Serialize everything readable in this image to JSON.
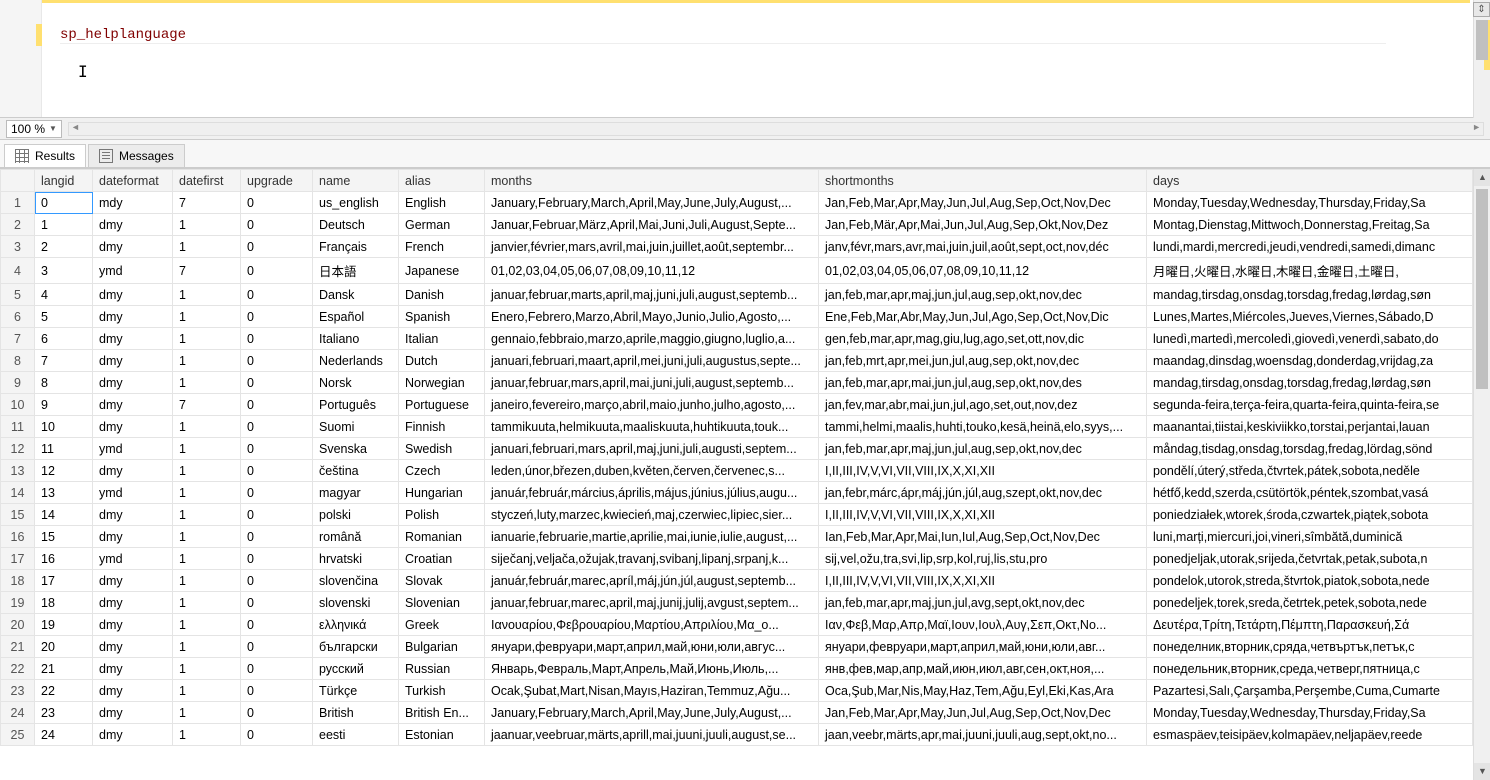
{
  "editor": {
    "sql_text": "sp_helplanguage",
    "zoom_label": "100 %"
  },
  "tabs": {
    "results_label": "Results",
    "messages_label": "Messages"
  },
  "grid": {
    "columns": [
      "langid",
      "dateformat",
      "datefirst",
      "upgrade",
      "name",
      "alias",
      "months",
      "shortmonths",
      "days"
    ],
    "rows": [
      {
        "n": "1",
        "langid": "0",
        "dateformat": "mdy",
        "datefirst": "7",
        "upgrade": "0",
        "name": "us_english",
        "alias": "English",
        "months": "January,February,March,April,May,June,July,August,...",
        "shortmonths": "Jan,Feb,Mar,Apr,May,Jun,Jul,Aug,Sep,Oct,Nov,Dec",
        "days": "Monday,Tuesday,Wednesday,Thursday,Friday,Sa"
      },
      {
        "n": "2",
        "langid": "1",
        "dateformat": "dmy",
        "datefirst": "1",
        "upgrade": "0",
        "name": "Deutsch",
        "alias": "German",
        "months": "Januar,Februar,März,April,Mai,Juni,Juli,August,Septe...",
        "shortmonths": "Jan,Feb,Mär,Apr,Mai,Jun,Jul,Aug,Sep,Okt,Nov,Dez",
        "days": "Montag,Dienstag,Mittwoch,Donnerstag,Freitag,Sa"
      },
      {
        "n": "3",
        "langid": "2",
        "dateformat": "dmy",
        "datefirst": "1",
        "upgrade": "0",
        "name": "Français",
        "alias": "French",
        "months": "janvier,février,mars,avril,mai,juin,juillet,août,septembr...",
        "shortmonths": "janv,févr,mars,avr,mai,juin,juil,août,sept,oct,nov,déc",
        "days": "lundi,mardi,mercredi,jeudi,vendredi,samedi,dimanc"
      },
      {
        "n": "4",
        "langid": "3",
        "dateformat": "ymd",
        "datefirst": "7",
        "upgrade": "0",
        "name": "日本語",
        "alias": "Japanese",
        "months": "01,02,03,04,05,06,07,08,09,10,11,12",
        "shortmonths": "01,02,03,04,05,06,07,08,09,10,11,12",
        "days": "月曜日,火曜日,水曜日,木曜日,金曜日,土曜日,"
      },
      {
        "n": "5",
        "langid": "4",
        "dateformat": "dmy",
        "datefirst": "1",
        "upgrade": "0",
        "name": "Dansk",
        "alias": "Danish",
        "months": "januar,februar,marts,april,maj,juni,juli,august,septemb...",
        "shortmonths": "jan,feb,mar,apr,maj,jun,jul,aug,sep,okt,nov,dec",
        "days": "mandag,tirsdag,onsdag,torsdag,fredag,lørdag,søn"
      },
      {
        "n": "6",
        "langid": "5",
        "dateformat": "dmy",
        "datefirst": "1",
        "upgrade": "0",
        "name": "Español",
        "alias": "Spanish",
        "months": "Enero,Febrero,Marzo,Abril,Mayo,Junio,Julio,Agosto,...",
        "shortmonths": "Ene,Feb,Mar,Abr,May,Jun,Jul,Ago,Sep,Oct,Nov,Dic",
        "days": "Lunes,Martes,Miércoles,Jueves,Viernes,Sábado,D"
      },
      {
        "n": "7",
        "langid": "6",
        "dateformat": "dmy",
        "datefirst": "1",
        "upgrade": "0",
        "name": "Italiano",
        "alias": "Italian",
        "months": "gennaio,febbraio,marzo,aprile,maggio,giugno,luglio,a...",
        "shortmonths": "gen,feb,mar,apr,mag,giu,lug,ago,set,ott,nov,dic",
        "days": "lunedì,martedì,mercoledì,giovedì,venerdì,sabato,do"
      },
      {
        "n": "8",
        "langid": "7",
        "dateformat": "dmy",
        "datefirst": "1",
        "upgrade": "0",
        "name": "Nederlands",
        "alias": "Dutch",
        "months": "januari,februari,maart,april,mei,juni,juli,augustus,septe...",
        "shortmonths": "jan,feb,mrt,apr,mei,jun,jul,aug,sep,okt,nov,dec",
        "days": "maandag,dinsdag,woensdag,donderdag,vrijdag,za"
      },
      {
        "n": "9",
        "langid": "8",
        "dateformat": "dmy",
        "datefirst": "1",
        "upgrade": "0",
        "name": "Norsk",
        "alias": "Norwegian",
        "months": "januar,februar,mars,april,mai,juni,juli,august,septemb...",
        "shortmonths": "jan,feb,mar,apr,mai,jun,jul,aug,sep,okt,nov,des",
        "days": "mandag,tirsdag,onsdag,torsdag,fredag,lørdag,søn"
      },
      {
        "n": "10",
        "langid": "9",
        "dateformat": "dmy",
        "datefirst": "7",
        "upgrade": "0",
        "name": "Português",
        "alias": "Portuguese",
        "months": "janeiro,fevereiro,março,abril,maio,junho,julho,agosto,...",
        "shortmonths": "jan,fev,mar,abr,mai,jun,jul,ago,set,out,nov,dez",
        "days": "segunda-feira,terça-feira,quarta-feira,quinta-feira,se"
      },
      {
        "n": "11",
        "langid": "10",
        "dateformat": "dmy",
        "datefirst": "1",
        "upgrade": "0",
        "name": "Suomi",
        "alias": "Finnish",
        "months": "tammikuuta,helmikuuta,maaliskuuta,huhtikuuta,touk...",
        "shortmonths": "tammi,helmi,maalis,huhti,touko,kesä,heinä,elo,syys,...",
        "days": "maanantai,tiistai,keskiviikko,torstai,perjantai,lauan"
      },
      {
        "n": "12",
        "langid": "11",
        "dateformat": "ymd",
        "datefirst": "1",
        "upgrade": "0",
        "name": "Svenska",
        "alias": "Swedish",
        "months": "januari,februari,mars,april,maj,juni,juli,augusti,septem...",
        "shortmonths": "jan,feb,mar,apr,maj,jun,jul,aug,sep,okt,nov,dec",
        "days": "måndag,tisdag,onsdag,torsdag,fredag,lördag,sönd"
      },
      {
        "n": "13",
        "langid": "12",
        "dateformat": "dmy",
        "datefirst": "1",
        "upgrade": "0",
        "name": "čeština",
        "alias": "Czech",
        "months": "leden,únor,březen,duben,květen,červen,červenec,s...",
        "shortmonths": "I,II,III,IV,V,VI,VII,VIII,IX,X,XI,XII",
        "days": "pondělí,úterý,středa,čtvrtek,pátek,sobota,neděle"
      },
      {
        "n": "14",
        "langid": "13",
        "dateformat": "ymd",
        "datefirst": "1",
        "upgrade": "0",
        "name": "magyar",
        "alias": "Hungarian",
        "months": "január,február,március,április,május,június,július,augu...",
        "shortmonths": "jan,febr,márc,ápr,máj,jún,júl,aug,szept,okt,nov,dec",
        "days": "hétfő,kedd,szerda,csütörtök,péntek,szombat,vasá"
      },
      {
        "n": "15",
        "langid": "14",
        "dateformat": "dmy",
        "datefirst": "1",
        "upgrade": "0",
        "name": "polski",
        "alias": "Polish",
        "months": "styczeń,luty,marzec,kwiecień,maj,czerwiec,lipiec,sier...",
        "shortmonths": "I,II,III,IV,V,VI,VII,VIII,IX,X,XI,XII",
        "days": "poniedziałek,wtorek,środa,czwartek,piątek,sobota"
      },
      {
        "n": "16",
        "langid": "15",
        "dateformat": "dmy",
        "datefirst": "1",
        "upgrade": "0",
        "name": "română",
        "alias": "Romanian",
        "months": "ianuarie,februarie,martie,aprilie,mai,iunie,iulie,august,...",
        "shortmonths": "Ian,Feb,Mar,Apr,Mai,Iun,Iul,Aug,Sep,Oct,Nov,Dec",
        "days": "luni,marți,miercuri,joi,vineri,sîmbătă,duminică"
      },
      {
        "n": "17",
        "langid": "16",
        "dateformat": "ymd",
        "datefirst": "1",
        "upgrade": "0",
        "name": "hrvatski",
        "alias": "Croatian",
        "months": "siječanj,veljača,ožujak,travanj,svibanj,lipanj,srpanj,k...",
        "shortmonths": "sij,vel,ožu,tra,svi,lip,srp,kol,ruj,lis,stu,pro",
        "days": "ponedjeljak,utorak,srijeda,četvrtak,petak,subota,n"
      },
      {
        "n": "18",
        "langid": "17",
        "dateformat": "dmy",
        "datefirst": "1",
        "upgrade": "0",
        "name": "slovenčina",
        "alias": "Slovak",
        "months": "január,február,marec,apríl,máj,jún,júl,august,septemb...",
        "shortmonths": "I,II,III,IV,V,VI,VII,VIII,IX,X,XI,XII",
        "days": "pondelok,utorok,streda,štvrtok,piatok,sobota,nede"
      },
      {
        "n": "19",
        "langid": "18",
        "dateformat": "dmy",
        "datefirst": "1",
        "upgrade": "0",
        "name": "slovenski",
        "alias": "Slovenian",
        "months": "januar,februar,marec,april,maj,junij,julij,avgust,septem...",
        "shortmonths": "jan,feb,mar,apr,maj,jun,jul,avg,sept,okt,nov,dec",
        "days": "ponedeljek,torek,sreda,četrtek,petek,sobota,nede"
      },
      {
        "n": "20",
        "langid": "19",
        "dateformat": "dmy",
        "datefirst": "1",
        "upgrade": "0",
        "name": "ελληνικά",
        "alias": "Greek",
        "months": "Ιανουαρίου,Φεβρουαρίου,Μαρτίου,Απριλίου,Μα_ο...",
        "shortmonths": "Ιαν,Φεβ,Μαρ,Απρ,Μαϊ,Ιουν,Ιουλ,Αυγ,Σεπ,Οκτ,Νο...",
        "days": "Δευτέρα,Τρίτη,Τετάρτη,Πέμπτη,Παρασκευή,Σά"
      },
      {
        "n": "21",
        "langid": "20",
        "dateformat": "dmy",
        "datefirst": "1",
        "upgrade": "0",
        "name": "български",
        "alias": "Bulgarian",
        "months": "януари,февруари,март,април,май,юни,юли,авгус...",
        "shortmonths": "януари,февруари,март,април,май,юни,юли,авг...",
        "days": "понеделник,вторник,сряда,четвъртък,петък,с"
      },
      {
        "n": "22",
        "langid": "21",
        "dateformat": "dmy",
        "datefirst": "1",
        "upgrade": "0",
        "name": "русский",
        "alias": "Russian",
        "months": "Январь,Февраль,Март,Апрель,Май,Июнь,Июль,...",
        "shortmonths": "янв,фев,мар,апр,май,июн,июл,авг,сен,окт,ноя,...",
        "days": "понедельник,вторник,среда,четверг,пятница,с"
      },
      {
        "n": "23",
        "langid": "22",
        "dateformat": "dmy",
        "datefirst": "1",
        "upgrade": "0",
        "name": "Türkçe",
        "alias": "Turkish",
        "months": "Ocak,Şubat,Mart,Nisan,Mayıs,Haziran,Temmuz,Ağu...",
        "shortmonths": "Oca,Şub,Mar,Nis,May,Haz,Tem,Ağu,Eyl,Eki,Kas,Ara",
        "days": "Pazartesi,Salı,Çarşamba,Perşembe,Cuma,Cumarte"
      },
      {
        "n": "24",
        "langid": "23",
        "dateformat": "dmy",
        "datefirst": "1",
        "upgrade": "0",
        "name": "British",
        "alias": "British En...",
        "months": "January,February,March,April,May,June,July,August,...",
        "shortmonths": "Jan,Feb,Mar,Apr,May,Jun,Jul,Aug,Sep,Oct,Nov,Dec",
        "days": "Monday,Tuesday,Wednesday,Thursday,Friday,Sa"
      },
      {
        "n": "25",
        "langid": "24",
        "dateformat": "dmy",
        "datefirst": "1",
        "upgrade": "0",
        "name": "eesti",
        "alias": "Estonian",
        "months": "jaanuar,veebruar,märts,aprill,mai,juuni,juuli,august,se...",
        "shortmonths": "jaan,veebr,märts,apr,mai,juuni,juuli,aug,sept,okt,no...",
        "days": "esmaspäev,teisipäev,kolmapäev,neljapäev,reede"
      }
    ]
  }
}
